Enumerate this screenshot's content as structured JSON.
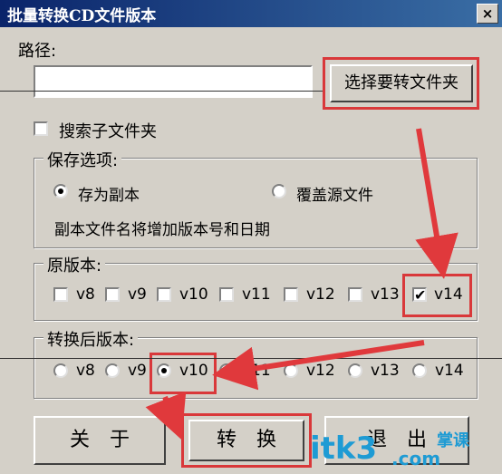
{
  "window": {
    "title": "批量转换CD文件版本",
    "close_label": "×"
  },
  "path": {
    "label": "路径:",
    "value": "",
    "browse_label": "选择要转文件夹"
  },
  "search_subfolders": {
    "label": "搜索子文件夹",
    "checked": false
  },
  "save_options": {
    "legend": "保存选项:",
    "options": [
      {
        "label": "存为副本",
        "selected": true
      },
      {
        "label": "覆盖源文件",
        "selected": false
      }
    ],
    "note": "副本文件名将增加版本号和日期"
  },
  "source_version": {
    "legend": "原版本:",
    "items": [
      {
        "label": "v8",
        "checked": false
      },
      {
        "label": "v9",
        "checked": false
      },
      {
        "label": "v10",
        "checked": false
      },
      {
        "label": "v11",
        "checked": false
      },
      {
        "label": "v12",
        "checked": false
      },
      {
        "label": "v13",
        "checked": false
      },
      {
        "label": "v14",
        "checked": true
      }
    ]
  },
  "target_version": {
    "legend": "转换后版本:",
    "items": [
      {
        "label": "v8",
        "selected": false
      },
      {
        "label": "v9",
        "selected": false
      },
      {
        "label": "v10",
        "selected": true
      },
      {
        "label": "v11",
        "selected": false
      },
      {
        "label": "v12",
        "selected": false
      },
      {
        "label": "v13",
        "selected": false
      },
      {
        "label": "v14",
        "selected": false
      }
    ]
  },
  "buttons": {
    "about": "关　于",
    "convert": "转　换",
    "exit": "退　出"
  },
  "watermark": {
    "text": "itk3",
    "suffix": ".com",
    "tag": "掌课"
  },
  "colors": {
    "highlight": "#d9383a",
    "dialog_bg": "#d4d0c8",
    "titlebar": "#0a246a"
  }
}
